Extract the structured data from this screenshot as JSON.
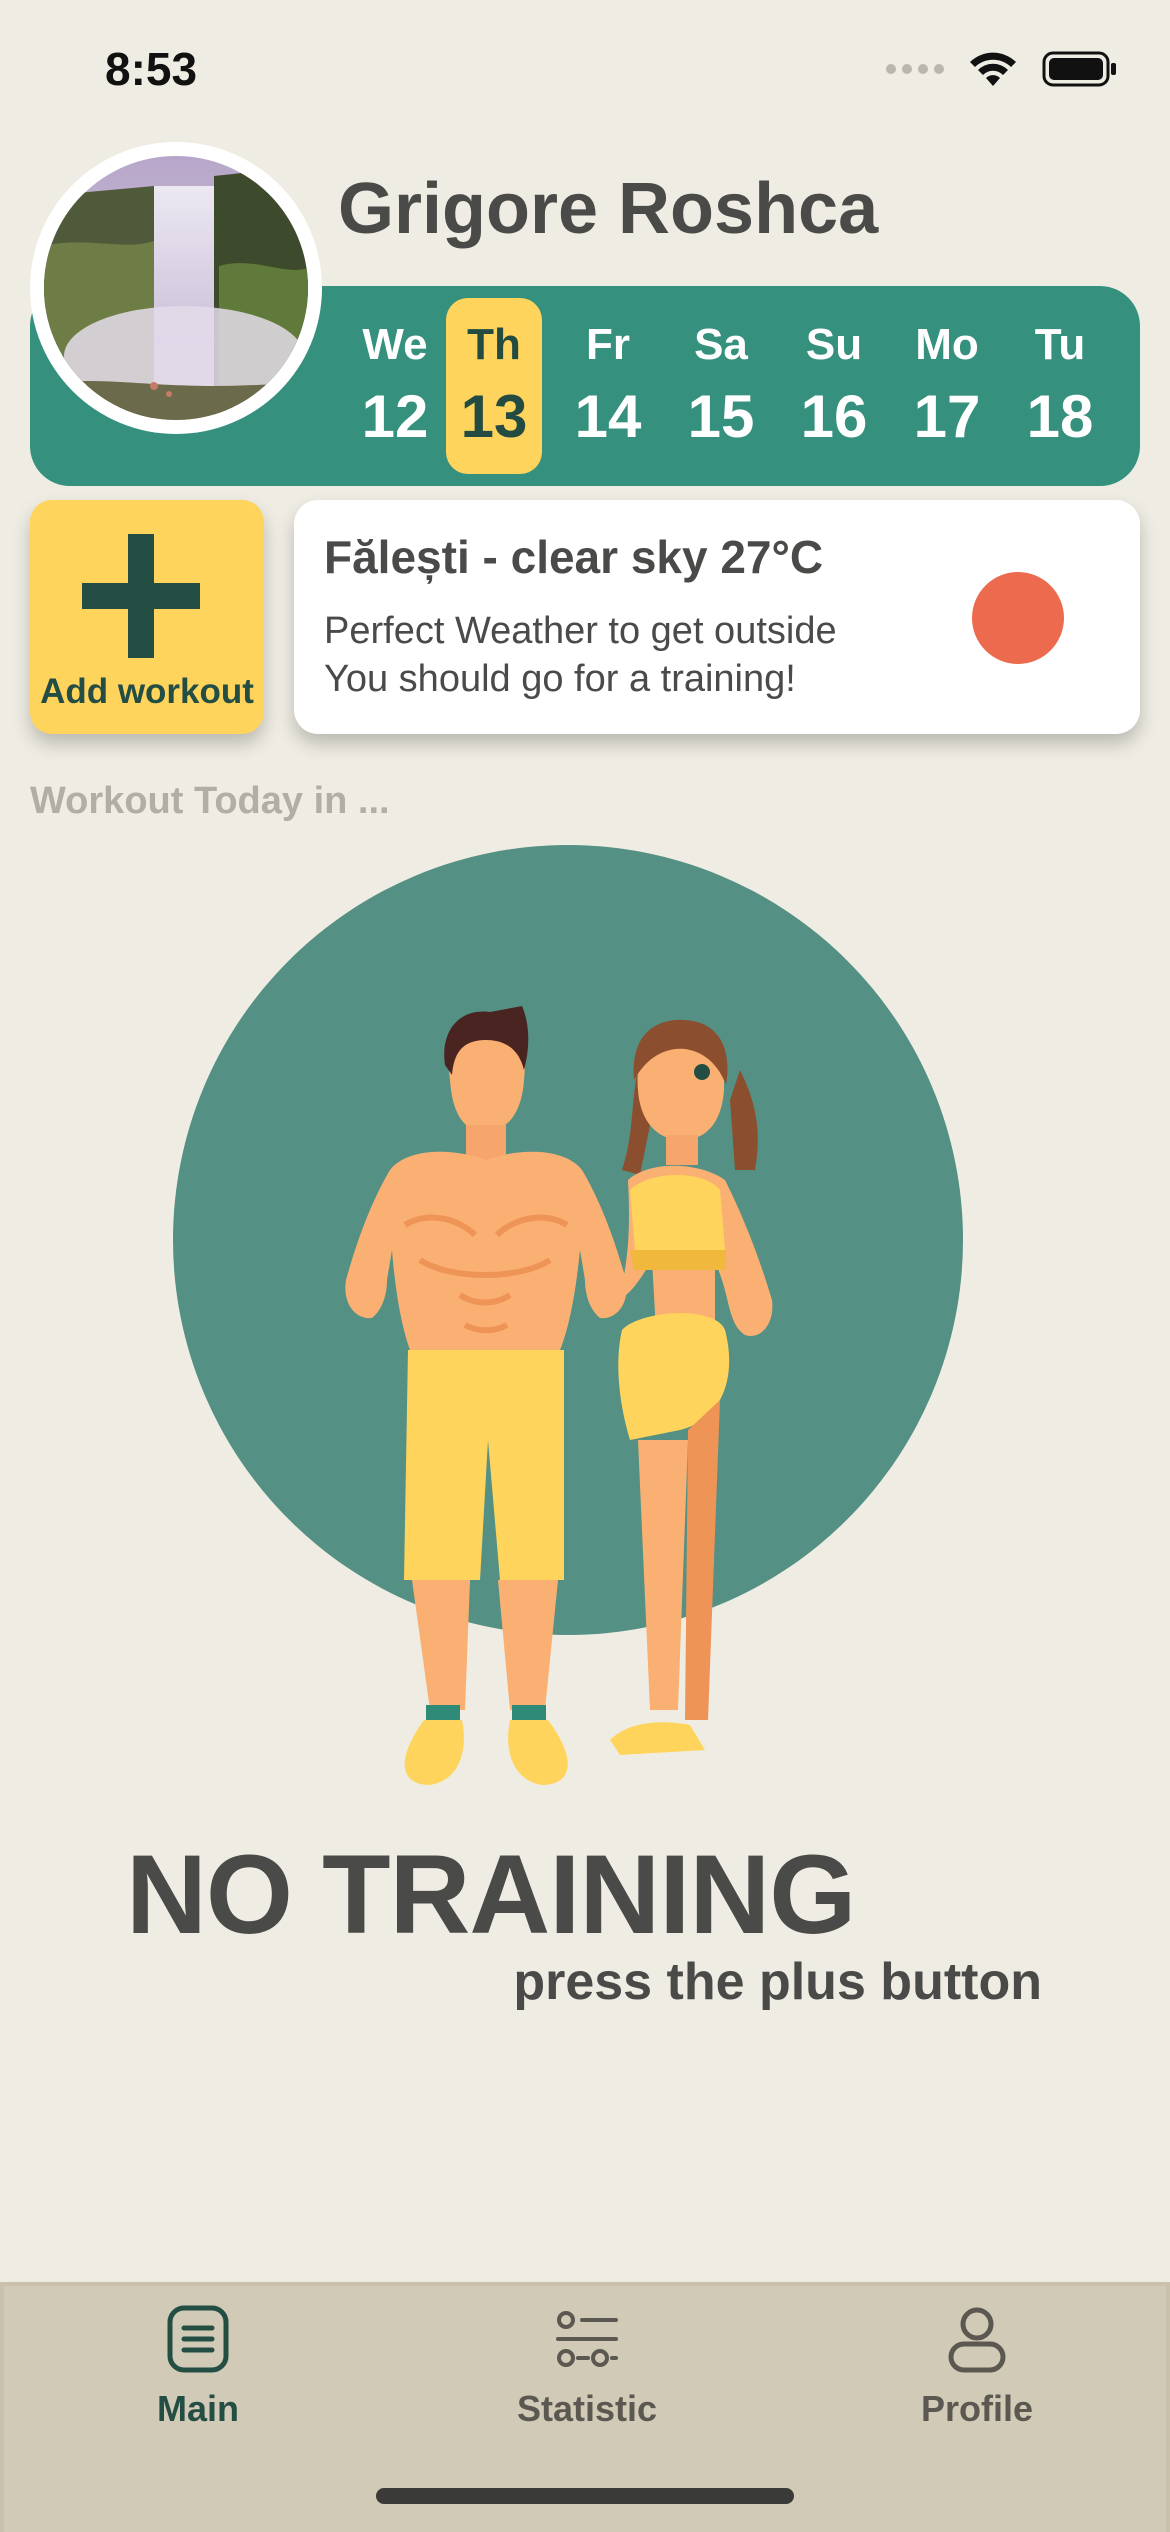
{
  "status_bar": {
    "time": "8:53"
  },
  "header": {
    "user_name": "Grigore Roshca"
  },
  "week": [
    {
      "day": "We",
      "date": "12",
      "selected": false
    },
    {
      "day": "Th",
      "date": "13",
      "selected": true
    },
    {
      "day": "Fr",
      "date": "14",
      "selected": false
    },
    {
      "day": "Sa",
      "date": "15",
      "selected": false
    },
    {
      "day": "Su",
      "date": "16",
      "selected": false
    },
    {
      "day": "Mo",
      "date": "17",
      "selected": false
    },
    {
      "day": "Tu",
      "date": "18",
      "selected": false
    }
  ],
  "add_workout": {
    "label": "Add workout",
    "icon": "plus-icon"
  },
  "weather": {
    "title": "Fălești - clear sky 27°C",
    "line1": "Perfect Weather to get outside",
    "line2": "You should go for a training!",
    "indicator_color": "#EC6B4E"
  },
  "section": {
    "label": "Workout Today in ..."
  },
  "empty_state": {
    "title": "NO TRAINING",
    "subtitle": "press the plus button"
  },
  "tabs": [
    {
      "label": "Main",
      "icon": "list-icon",
      "active": true
    },
    {
      "label": "Statistic",
      "icon": "sliders-icon",
      "active": false
    },
    {
      "label": "Profile",
      "icon": "person-icon",
      "active": false
    }
  ],
  "colors": {
    "background": "#EFEDE3",
    "accent_green": "#35907D",
    "accent_yellow": "#FFD45C",
    "tab_bar": "#D1CAB6",
    "dark_green": "#244D43"
  }
}
